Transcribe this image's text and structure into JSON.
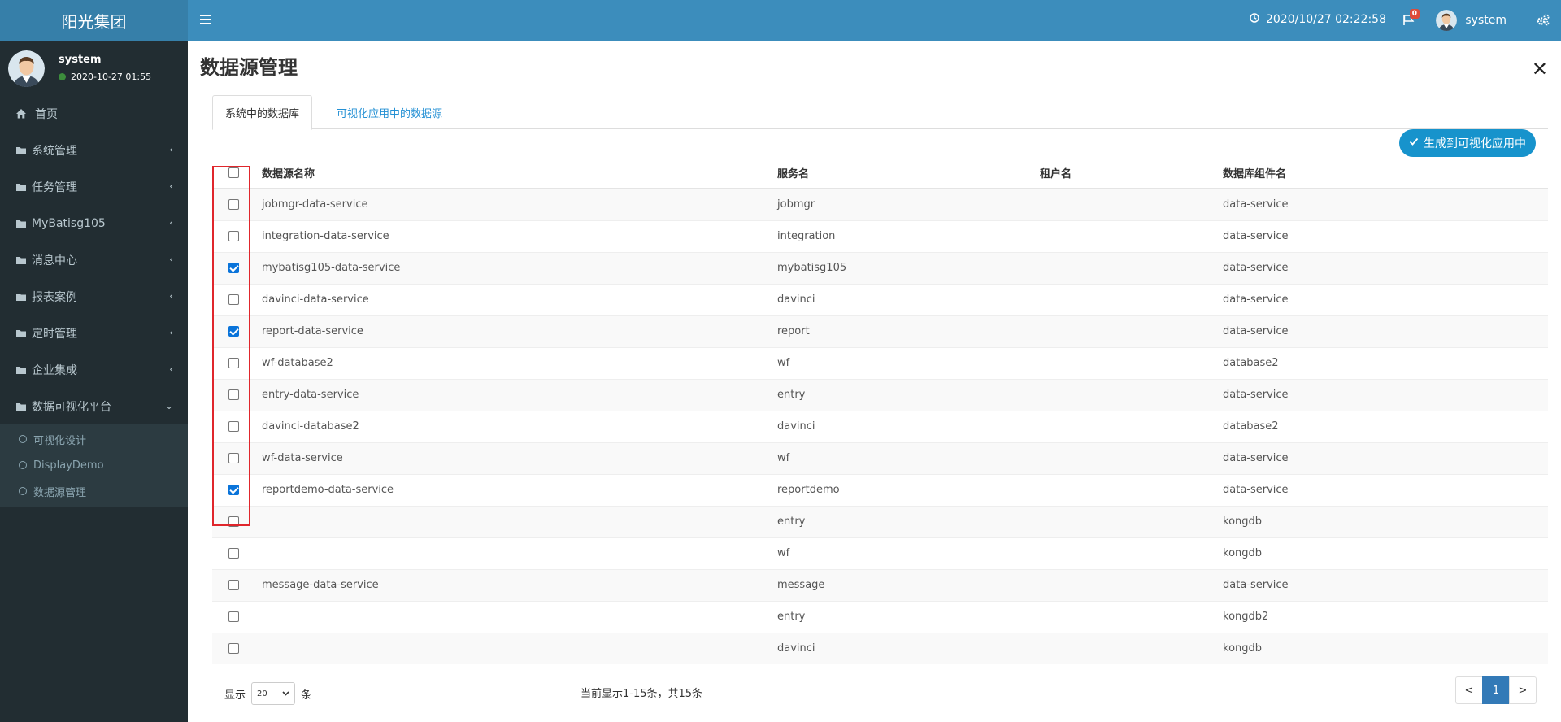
{
  "brand": "阳光集团",
  "user": {
    "name": "system",
    "login_time": "2020-10-27 01:55"
  },
  "sidebar": {
    "items": [
      {
        "label": "首页"
      },
      {
        "label": "系统管理"
      },
      {
        "label": "任务管理"
      },
      {
        "label": "MyBatisg105"
      },
      {
        "label": "消息中心"
      },
      {
        "label": "报表案例"
      },
      {
        "label": "定时管理"
      },
      {
        "label": "企业集成"
      },
      {
        "label": "数据可视化平台"
      }
    ],
    "submenu": [
      {
        "label": "可视化设计"
      },
      {
        "label": "DisplayDemo"
      },
      {
        "label": "数据源管理"
      }
    ]
  },
  "header": {
    "datetime": "2020/10/27 02:22:58",
    "notification_count": "0",
    "user_name": "system"
  },
  "page": {
    "title": "数据源管理",
    "tabs": [
      {
        "label": "系统中的数据库"
      },
      {
        "label": "可视化应用中的数据源"
      }
    ],
    "generate_button": "生成到可视化应用中"
  },
  "table": {
    "columns": [
      "数据源名称",
      "服务名",
      "租户名",
      "数据库组件名"
    ],
    "rows": [
      {
        "name": "jobmgr-data-service",
        "service": "jobmgr",
        "tenant": "",
        "component": "data-service",
        "checked": false
      },
      {
        "name": "integration-data-service",
        "service": "integration",
        "tenant": "",
        "component": "data-service",
        "checked": false
      },
      {
        "name": "mybatisg105-data-service",
        "service": "mybatisg105",
        "tenant": "",
        "component": "data-service",
        "checked": true
      },
      {
        "name": "davinci-data-service",
        "service": "davinci",
        "tenant": "",
        "component": "data-service",
        "checked": false
      },
      {
        "name": "report-data-service",
        "service": "report",
        "tenant": "",
        "component": "data-service",
        "checked": true
      },
      {
        "name": "wf-database2",
        "service": "wf",
        "tenant": "",
        "component": "database2",
        "checked": false
      },
      {
        "name": "entry-data-service",
        "service": "entry",
        "tenant": "",
        "component": "data-service",
        "checked": false
      },
      {
        "name": "davinci-database2",
        "service": "davinci",
        "tenant": "",
        "component": "database2",
        "checked": false
      },
      {
        "name": "wf-data-service",
        "service": "wf",
        "tenant": "",
        "component": "data-service",
        "checked": false
      },
      {
        "name": "reportdemo-data-service",
        "service": "reportdemo",
        "tenant": "",
        "component": "data-service",
        "checked": true
      },
      {
        "name": "",
        "service": "entry",
        "tenant": "",
        "component": "kongdb",
        "checked": false
      },
      {
        "name": "",
        "service": "wf",
        "tenant": "",
        "component": "kongdb",
        "checked": false
      },
      {
        "name": "message-data-service",
        "service": "message",
        "tenant": "",
        "component": "data-service",
        "checked": false
      },
      {
        "name": "",
        "service": "entry",
        "tenant": "",
        "component": "kongdb2",
        "checked": false
      },
      {
        "name": "",
        "service": "davinci",
        "tenant": "",
        "component": "kongdb",
        "checked": false
      }
    ]
  },
  "footer": {
    "show_label": "显示",
    "page_size": "20",
    "unit_label": "条",
    "summary": "当前显示1-15条，共15条",
    "prev": "<",
    "current_page": "1",
    "next": ">"
  },
  "colors": {
    "sidebar_bg": "#222d32",
    "header_bg": "#3c8dbc",
    "logo_bg": "#367fa9",
    "accent": "#1793cc",
    "highlight": "#e0262c"
  }
}
